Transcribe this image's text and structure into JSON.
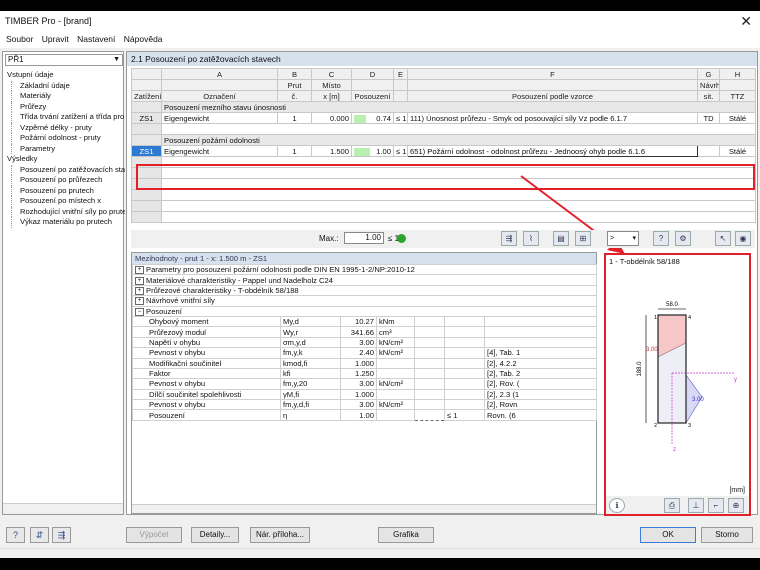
{
  "window": {
    "title": "TIMBER Pro - [brand]",
    "close_icon": "close-icon"
  },
  "menu": [
    "Soubor",
    "Upravit",
    "Nastavení",
    "Nápověda"
  ],
  "sidebar": {
    "selector": "PŘ1",
    "tree": [
      {
        "label": "Vstupní údaje",
        "level": 1
      },
      {
        "label": "Základní údaje",
        "level": 2
      },
      {
        "label": "Materiály",
        "level": 2
      },
      {
        "label": "Průřezy",
        "level": 2
      },
      {
        "label": "Třída trvání zatížení a třída pro",
        "level": 2
      },
      {
        "label": "Vzpěrné délky - pruty",
        "level": 2
      },
      {
        "label": "Požární odolnost - pruty",
        "level": 2
      },
      {
        "label": "Parametry",
        "level": 2
      },
      {
        "label": "Výsledky",
        "level": 1
      },
      {
        "label": "Posouzení po zatěžovacích stav",
        "level": 2
      },
      {
        "label": "Posouzení po průřezech",
        "level": 2
      },
      {
        "label": "Posouzení po prutech",
        "level": 2
      },
      {
        "label": "Posouzení po místech x",
        "level": 2
      },
      {
        "label": "Rozhodující vnitřní síly po prute",
        "level": 2
      },
      {
        "label": "Výkaz materiálu po prutech",
        "level": 2
      }
    ]
  },
  "main": {
    "header": "2.1  Posouzení po zatěžovacích stavech",
    "columns": {
      "letters": [
        "A",
        "B",
        "C",
        "D",
        "E",
        "F",
        "G",
        "H"
      ],
      "row_label": "Zatížení",
      "a": "Označení",
      "b1": "Prut",
      "b2": "č.",
      "c1": "Místo",
      "c2": "x [m]",
      "d": "Posouzení",
      "f": "Posouzení podle vzorce",
      "g1": "Návrh",
      "g2": "sit.",
      "h": "TTZ"
    },
    "section1": "Posouzení mezního stavu únosnosti",
    "row1": {
      "zs": "ZS1",
      "a": "Eigengewicht",
      "b": "1",
      "c": "0.000",
      "d": "0.74",
      "e": "≤ 1",
      "f": "111) Únosnost průřezu - Smyk od posouvající síly Vz podle 6.1.7",
      "g": "TD",
      "h": "Stálé",
      "ratio": 0.74
    },
    "section2": "Posouzení požární odolnosti",
    "row2": {
      "zs": "ZS1",
      "a": "Eigengewicht",
      "b": "1",
      "c": "1.500",
      "d": "1.00",
      "e": "≤ 1",
      "f": "651) Požární odolnost - odolnost průřezu - Jednoosý ohyb podle 6.1.6",
      "g": "",
      "h": "Stálé",
      "ratio": 1.0
    },
    "max_label": "Max.:",
    "max_value": "1.00",
    "max_le": "≤ 1",
    "dropdown": ">"
  },
  "details": {
    "header": "Mezihodnoty - prut 1 - x: 1.500 m - ZS1",
    "groups": [
      "Parametry pro posouzení požární odolnosti podle DIN EN 1995-1-2/NP:2010-12",
      "Materiálové charakteristiky - Pappel und Nadelholz C24",
      "Průřezové charakteristiky - T-obdélník 58/188",
      "Návrhové vnitřní síly",
      "Posouzení"
    ],
    "rows": [
      {
        "name": "Ohybový moment",
        "sym": "My,d",
        "val": "10.27",
        "unit": "kNm",
        "lim": "",
        "ref": ""
      },
      {
        "name": "Průřezový modul",
        "sym": "Wy,r",
        "val": "341.66",
        "unit": "cm³",
        "lim": "",
        "ref": ""
      },
      {
        "name": "Napětí v ohybu",
        "sym": "σm,y,d",
        "val": "3.00",
        "unit": "kN/cm²",
        "lim": "",
        "ref": ""
      },
      {
        "name": "Pevnost v ohybu",
        "sym": "fm,y,k",
        "val": "2.40",
        "unit": "kN/cm²",
        "lim": "",
        "ref": "[4], Tab. 1"
      },
      {
        "name": "Modifikační součinitel",
        "sym": "kmod,fi",
        "val": "1.000",
        "unit": "",
        "lim": "",
        "ref": "[2], 4.2.2"
      },
      {
        "name": "Faktor",
        "sym": "kfi",
        "val": "1.250",
        "unit": "",
        "lim": "",
        "ref": "[2], Tab. 2"
      },
      {
        "name": "Pevnost v ohybu",
        "sym": "fm,y,20",
        "val": "3.00",
        "unit": "kN/cm²",
        "lim": "",
        "ref": "[2], Rov. ("
      },
      {
        "name": "Dílčí součinitel spolehlivosti",
        "sym": "γM,fi",
        "val": "1.000",
        "unit": "",
        "lim": "",
        "ref": "[2], 2.3 (1"
      },
      {
        "name": "Pevnost v ohybu",
        "sym": "fm,y,d,fi",
        "val": "3.00",
        "unit": "kN/cm²",
        "lim": "",
        "ref": "[2], Rovn"
      },
      {
        "name": "Posouzení",
        "sym": "η",
        "val": "1.00",
        "unit": "",
        "lim": "≤ 1",
        "ref": "Rovn. (6"
      }
    ]
  },
  "graphic": {
    "title": "1 - T-obdélník 58/188",
    "width_label": "58.0",
    "height_label": "188.0",
    "p1": "1",
    "p2": "2",
    "p3": "3",
    "p4": "4",
    "stress_top": "3.00",
    "stress_right": "3.00",
    "axis_y": "y",
    "axis_z": "z",
    "units": "[mm]"
  },
  "bottom": {
    "calc": "Výpočet",
    "details": "Detaily...",
    "annex": "Nár. příloha...",
    "graphic": "Grafika",
    "ok": "OK",
    "cancel": "Storno"
  }
}
